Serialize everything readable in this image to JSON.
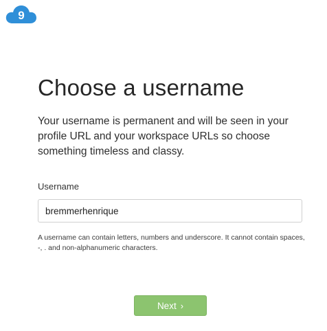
{
  "logo": {
    "icon": "cloud-nine-logo-icon",
    "glyph": "9",
    "color": "#2f8fd8"
  },
  "heading": {
    "title": "Choose a username",
    "subtitle": "Your username is permanent and will be seen in your profile URL and your workspace URLs so choose something timeless and classy."
  },
  "form": {
    "username_label": "Username",
    "username_value": "bremmerhenrique",
    "hint": "A username can contain letters, numbers and underscore. It cannot contain spaces, -, . and non-alphanumeric characters."
  },
  "actions": {
    "next_label": "Next",
    "next_icon": "chevron-right-icon",
    "next_glyph": "›",
    "next_color": "#8cc46f"
  }
}
